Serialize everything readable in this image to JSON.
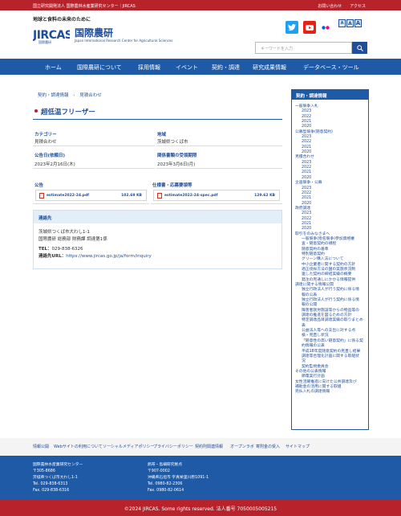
{
  "topbar": {
    "org": "国立研究開発法人 国際農林水産業研究センター｜JIRCAS",
    "links": [
      "お問い合わせ",
      "アクセス"
    ]
  },
  "header": {
    "tagline": "地球と食料の未来のために",
    "logo_text": "JIRCAS",
    "logo_sub": "国際農研",
    "site_title": "国際農研",
    "site_en": "Japan International Research Center for Agricultural Sciences",
    "font_sizes": [
      "A",
      "A",
      "A"
    ],
    "search_placeholder": "キーワードを入力"
  },
  "nav": [
    "ホーム",
    "国際農研について",
    "採用情報",
    "イベント",
    "契約・調達",
    "研究成果情報",
    "データベース・ツール"
  ],
  "breadcrumb": [
    "契約・調達情報",
    "見積合わせ"
  ],
  "page_title": "超低温フリーザー",
  "info": {
    "category_label": "カテゴリー",
    "category_value": "見積合わせ",
    "region_label": "地域",
    "region_value": "茨城県つくば市",
    "published_label": "公告日(依頼日)",
    "published_value": "2023年2月16日(木)",
    "deadline_label": "関係書類の受領期限",
    "deadline_value": "2023年3月6日(月)"
  },
  "files": {
    "notice_label": "公告",
    "notice_file": "estimate2022-24.pdf",
    "notice_size": "102.69 KB",
    "spec_label": "仕様書・応募要領等",
    "spec_file": "estimate2022-24-spec.pdf",
    "spec_size": "129.62 KB"
  },
  "contact": {
    "heading": "連絡先",
    "address": "茨城県つくば市大わし1-1",
    "dept": "国際農研 総務部 財務課 調達第1係",
    "tel_label": "TEL：",
    "tel": "029-838-6326",
    "url_label": "連絡先URL：",
    "url": "https://www.jircas.go.jp/ja/form/inquiry"
  },
  "sidebar": {
    "heading": "契約・調達情報",
    "rows": [
      {
        "t": "一般競争入札",
        "l": 0
      },
      {
        "t": "2023",
        "l": 1
      },
      {
        "t": "2022",
        "l": 1
      },
      {
        "t": "2021",
        "l": 1
      },
      {
        "t": "2020",
        "l": 1
      },
      {
        "t": "公募型競争(随意契約)",
        "l": 0
      },
      {
        "t": "2023",
        "l": 1
      },
      {
        "t": "2022",
        "l": 1
      },
      {
        "t": "2021",
        "l": 1
      },
      {
        "t": "2020",
        "l": 1
      },
      {
        "t": "見積合わせ",
        "l": 0
      },
      {
        "t": "2023",
        "l": 1
      },
      {
        "t": "2022",
        "l": 1
      },
      {
        "t": "2021",
        "l": 1
      },
      {
        "t": "2020",
        "l": 1
      },
      {
        "t": "企画競争・公募",
        "l": 0
      },
      {
        "t": "2023",
        "l": 1
      },
      {
        "t": "2022",
        "l": 1
      },
      {
        "t": "2021",
        "l": 1
      },
      {
        "t": "2020",
        "l": 1
      },
      {
        "t": "政府調達",
        "l": 0
      },
      {
        "t": "2023",
        "l": 1
      },
      {
        "t": "2022",
        "l": 1
      },
      {
        "t": "2021",
        "l": 1
      },
      {
        "t": "2020",
        "l": 1
      },
      {
        "t": "取引をのみなさまへ",
        "l": 0
      },
      {
        "t": "一般競争(指名競争)参加資格審",
        "l": 1
      },
      {
        "t": "査・随意契約の規程",
        "l": 1
      },
      {
        "t": "随意契約の基準",
        "l": 1
      },
      {
        "t": "特別随意契約",
        "l": 1
      },
      {
        "t": "グリーン購入法について",
        "l": 1
      },
      {
        "t": "中小企業者に関する契約の方針",
        "l": 1
      },
      {
        "t": "適正伐採方法の国の実施状況制",
        "l": 1
      },
      {
        "t": "連した契約の締結実績の概要",
        "l": 1
      },
      {
        "t": "発注の見通しにかかる情報提供",
        "l": 1
      },
      {
        "t": "調達に関する情報公開",
        "l": 0
      },
      {
        "t": "独立行政法人が行う契約に係る情",
        "l": 1
      },
      {
        "t": "報の公表",
        "l": 1
      },
      {
        "t": "独立行政法人が行う契約に係る情",
        "l": 1
      },
      {
        "t": "報の公開",
        "l": 1
      },
      {
        "t": "障害者就労施設等からの物品等の",
        "l": 1
      },
      {
        "t": "調達の推進を図るための方針",
        "l": 1
      },
      {
        "t": "特定調達品目調達実績の取りまとめ",
        "l": 1
      },
      {
        "t": "表",
        "l": 1
      },
      {
        "t": "公益法人等への支出に対する点",
        "l": 1
      },
      {
        "t": "検・見直し状況",
        "l": 1
      },
      {
        "t": "「随意性の高い随意契約」に係る契",
        "l": 1
      },
      {
        "t": "約情報の公表",
        "l": 1
      },
      {
        "t": "平成18年度随意契約の見直し結果",
        "l": 1
      },
      {
        "t": "調達等合理化計画に関する取組状",
        "l": 1
      },
      {
        "t": "況",
        "l": 1
      },
      {
        "t": "契約監視委員会",
        "l": 1
      },
      {
        "t": "その他の公表情報",
        "l": 0
      },
      {
        "t": "節電実行計画",
        "l": 1
      },
      {
        "t": "女性活躍推進に向けた公共調達及び",
        "l": 0
      },
      {
        "t": "補助金の活用に関する取組",
        "l": 0
      },
      {
        "t": "売払入札の調達情報",
        "l": 0
      }
    ]
  },
  "footer_links": [
    "情報公開",
    "Webサイトの利用について",
    "ソーシャルメディアポリシー",
    "プライバシーポリシー",
    "契約則関連情報",
    "オープンラボ",
    "寄附金の受入",
    "サイトマップ"
  ],
  "footer": {
    "hq": [
      "国際農林水産業研究センター",
      "〒305-8686",
      "茨城県つくば市大わし1-1",
      "Tel. 029-838-6313",
      "Fax. 029-838-6316"
    ],
    "okinawa": [
      "熱帯・島嶼研究拠点",
      "〒907-0002",
      "沖縄県石垣市 字真栄里川原1091-1",
      "Tel. 0980-82-2306",
      "Fax. 0980-82-0614"
    ]
  },
  "copyright": "©2024 JIRCAS. Some rights reserved. 法人番号 7050005005215",
  "colors": {
    "brand_blue": "#1f5aa6",
    "brand_red": "#b8222b"
  }
}
